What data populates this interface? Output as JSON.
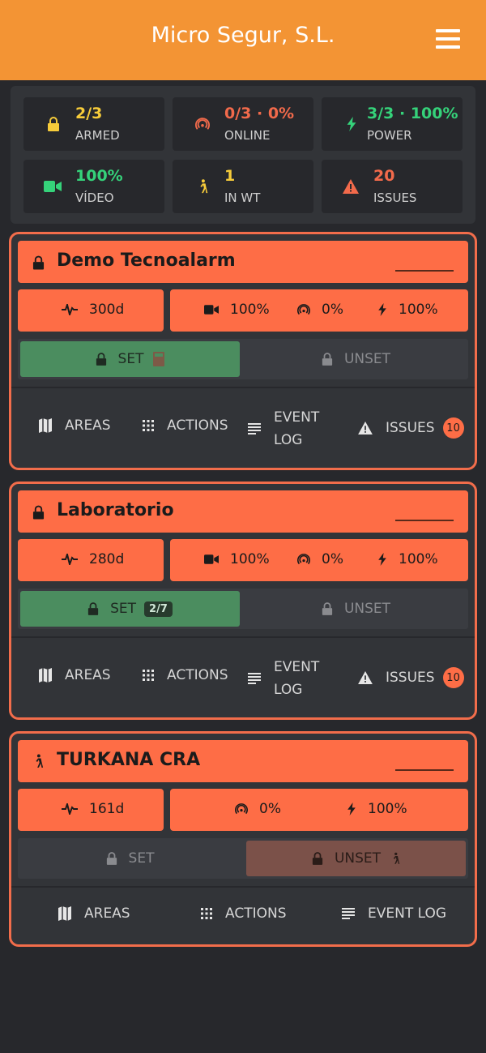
{
  "header": {
    "title": "Micro Segur, S.L.",
    "menu_icon": "hamburger-menu-icon"
  },
  "summary": {
    "armed": {
      "value": "2/3",
      "label": "ARMED",
      "icon": "lock-icon",
      "color": "#f7cc3a"
    },
    "online": {
      "value": "0/3 · 0%",
      "label": "ONLINE",
      "icon": "signal-icon",
      "color": "#f26a4b"
    },
    "power": {
      "value": "3/3 · 100%",
      "label": "POWER",
      "icon": "bolt-icon",
      "color": "#35d27a"
    },
    "video": {
      "value": "100%",
      "label": "VÍDEO",
      "icon": "video-camera-icon",
      "color": "#35d27a"
    },
    "in_wt": {
      "value": "1",
      "label": "IN WT",
      "icon": "walking-person-icon",
      "color": "#f7cc3a"
    },
    "issues": {
      "value": "20",
      "label": "ISSUES",
      "icon": "warning-icon",
      "color": "#f26a4b"
    }
  },
  "sites": [
    {
      "name": "Demo Tecnoalarm",
      "uptime": "300d",
      "video": "100%",
      "signal": "0%",
      "power": "100%",
      "set_label": "SET",
      "unset_label": "UNSET",
      "areas_label": "AREAS",
      "actions_label": "ACTIONS",
      "event_log_1": "EVENT",
      "event_log_2": "LOG",
      "issues_label": "ISSUES",
      "issues_count": "10"
    },
    {
      "name": "Laboratorio",
      "uptime": "280d",
      "video": "100%",
      "signal": "0%",
      "power": "100%",
      "set_label": "SET",
      "set_badge": "2/7",
      "unset_label": "UNSET",
      "areas_label": "AREAS",
      "actions_label": "ACTIONS",
      "event_log_1": "EVENT",
      "event_log_2": "LOG",
      "issues_label": "ISSUES",
      "issues_count": "10"
    },
    {
      "name": "TURKANA CRA",
      "uptime": "161d",
      "signal": "0%",
      "power": "100%",
      "set_label": "SET",
      "unset_label": "UNSET",
      "areas_label": "AREAS",
      "actions_label": "ACTIONS",
      "event_log": "EVENT LOG"
    }
  ],
  "colors": {
    "accent": "#f39434",
    "site": "#fe6d46",
    "armed_green": "#4b8d5f"
  }
}
